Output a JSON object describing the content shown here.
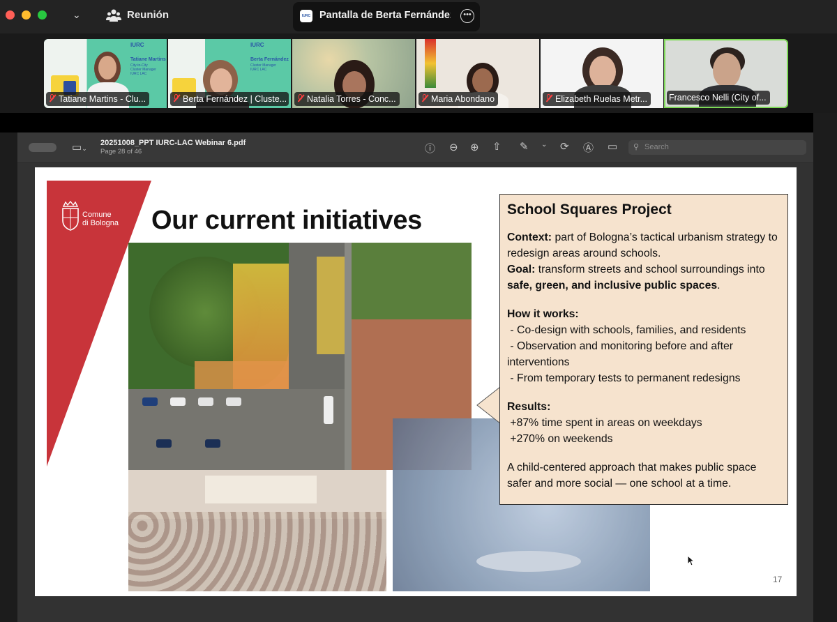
{
  "window": {
    "meeting_title": "Reunión",
    "share_tab_title": "Pantalla de Berta Fernández",
    "share_logo_text": "IURC"
  },
  "participants": [
    {
      "name": "Tatiane Martins  - Clu..."
    },
    {
      "name": "Berta Fernández | Cluste..."
    },
    {
      "name": "Natalia Torres - Conc..."
    },
    {
      "name": "Maria Abondano"
    },
    {
      "name": "Elizabeth Ruelas Metr..."
    },
    {
      "name": "Francesco Nelli (City of..."
    }
  ],
  "tile_cards": [
    {
      "brand": "IURC",
      "name": "Tatiane Martins",
      "role1": "City-to-City",
      "role2": "Cluster Manager",
      "role3": "IURC LAC"
    },
    {
      "brand": "IURC",
      "name": "Berta Fernández",
      "role1": "Cluster Manager",
      "role2": "IURC LAC",
      "role3": ""
    }
  ],
  "pdf": {
    "filename": "20251008_PPT IURC-LAC Webinar 6.pdf",
    "page_info": "Page 28 of 46",
    "search_placeholder": "Search"
  },
  "slide": {
    "org_name_line1": "Comune",
    "org_name_line2": "di Bologna",
    "title": "Our current initiatives",
    "box_title": "School Squares Project",
    "context_label": "Context:",
    "context_text": " part of Bologna’s tactical urbanism strategy to redesign areas around schools.",
    "goal_label": "Goal:",
    "goal_text": " transform streets and school surroundings into ",
    "goal_bold": "safe, green, and inclusive public spaces",
    "goal_end": ".",
    "how_label": "How it works:",
    "how_items": [
      " - Co-design with schools, families, and residents",
      " - Observation and monitoring before and after interventions",
      " - From temporary tests to permanent redesigns"
    ],
    "results_label": "Results:",
    "results_items": [
      " +87% time spent in areas on weekdays",
      " +270% on weekends"
    ],
    "closing": "A child-centered approach that makes public space safer and more social — one school at a time.",
    "page_number": "17"
  },
  "colors": {
    "accent_red": "#c8343a",
    "box_fill": "#f6e3ce",
    "tile_green_border": "#7ed957"
  }
}
